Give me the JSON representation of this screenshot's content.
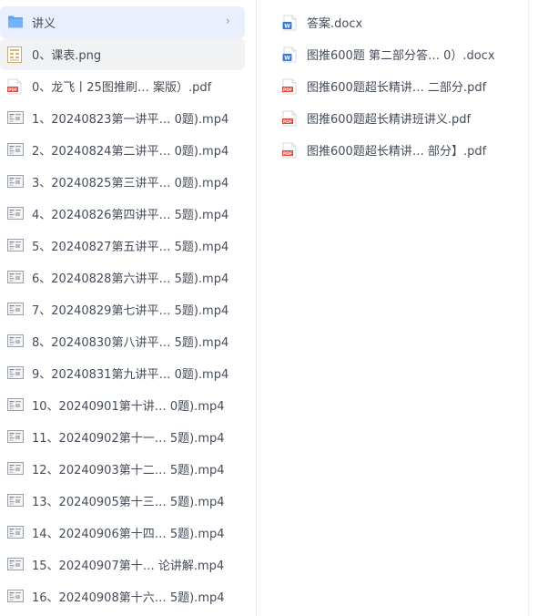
{
  "left_items": [
    {
      "label": "讲义",
      "type": "folder",
      "state": "active",
      "chevron": "›"
    },
    {
      "label": "0、课表.png",
      "type": "image",
      "state": "hover"
    },
    {
      "label": "0、龙飞丨25图推刷…   案版）.pdf",
      "type": "pdf",
      "state": ""
    },
    {
      "label": "1、20240823第一讲平… 0题).mp4",
      "type": "video",
      "state": ""
    },
    {
      "label": "2、20240824第二讲平… 0题).mp4",
      "type": "video",
      "state": ""
    },
    {
      "label": "3、20240825第三讲平… 0题).mp4",
      "type": "video",
      "state": ""
    },
    {
      "label": "4、20240826第四讲平… 5题).mp4",
      "type": "video",
      "state": ""
    },
    {
      "label": "5、20240827第五讲平… 5题).mp4",
      "type": "video",
      "state": ""
    },
    {
      "label": "6、20240828第六讲平… 5题).mp4",
      "type": "video",
      "state": ""
    },
    {
      "label": "7、20240829第七讲平… 5题).mp4",
      "type": "video",
      "state": ""
    },
    {
      "label": "8、20240830第八讲平… 5题).mp4",
      "type": "video",
      "state": ""
    },
    {
      "label": "9、20240831第九讲平… 0题).mp4",
      "type": "video",
      "state": ""
    },
    {
      "label": "10、20240901第十讲…  0题).mp4",
      "type": "video",
      "state": ""
    },
    {
      "label": "11、20240902第十一…  5题).mp4",
      "type": "video",
      "state": ""
    },
    {
      "label": "12、20240903第十二…  5题).mp4",
      "type": "video",
      "state": ""
    },
    {
      "label": "13、20240905第十三…  5题).mp4",
      "type": "video",
      "state": ""
    },
    {
      "label": "14、20240906第十四…  5题).mp4",
      "type": "video",
      "state": ""
    },
    {
      "label": "15、20240907第十…  论讲解.mp4",
      "type": "video",
      "state": ""
    },
    {
      "label": "16、20240908第十六…  5题).mp4",
      "type": "video",
      "state": ""
    }
  ],
  "right_items": [
    {
      "label": "答案.docx",
      "type": "docx"
    },
    {
      "label": "图推600题 第二部分答…  0）.docx",
      "type": "docx"
    },
    {
      "label": "图推600题超长精讲…   二部分.pdf",
      "type": "pdf"
    },
    {
      "label": "图推600题超长精讲班讲义.pdf",
      "type": "pdf"
    },
    {
      "label": "图推600题超长精讲…   部分】.pdf",
      "type": "pdf"
    }
  ],
  "colors": {
    "folder": "#5aa3f5",
    "pdf": "#e2463a",
    "docx": "#3a78d8",
    "selected_bg": "#e9effd",
    "hover_bg": "#f1f2f4"
  },
  "icons": {
    "folder": "folder-icon",
    "image": "image-file-icon",
    "pdf": "pdf-file-icon",
    "video": "video-thumbnail-icon",
    "docx": "word-file-icon"
  }
}
